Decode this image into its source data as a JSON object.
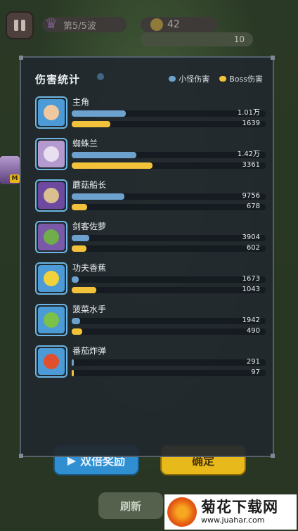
{
  "hud": {
    "wave": "第5/5波",
    "coins": "42",
    "progress": "10"
  },
  "panel": {
    "title": "伤害统计",
    "legend": {
      "mob": "小怪伤害",
      "boss": "Boss伤害"
    },
    "colors": {
      "mob": "#6da2cf",
      "boss": "#f2c23b"
    },
    "rows": [
      {
        "name": "主角",
        "mob": "1.01万",
        "boss": "1639",
        "mob_pct": 0.28,
        "boss_pct": 0.2,
        "bg": "#4d9bd6",
        "face": "#f0c8a0"
      },
      {
        "name": "蜘蛛兰",
        "mob": "1.42万",
        "boss": "3361",
        "mob_pct": 0.335,
        "boss_pct": 0.415,
        "bg": "#b59ad0",
        "face": "#e8e0f0"
      },
      {
        "name": "蘑菇船长",
        "mob": "9756",
        "boss": "678",
        "mob_pct": 0.272,
        "boss_pct": 0.08,
        "bg": "#6d4aa0",
        "face": "#d9c090"
      },
      {
        "name": "剑客佐萝",
        "mob": "3904",
        "boss": "602",
        "mob_pct": 0.09,
        "boss_pct": 0.075,
        "bg": "#7a5aa8",
        "face": "#6fae4a"
      },
      {
        "name": "功夫香蕉",
        "mob": "1673",
        "boss": "1043",
        "mob_pct": 0.035,
        "boss_pct": 0.125,
        "bg": "#4d9bd6",
        "face": "#f2d23a"
      },
      {
        "name": "菠菜水手",
        "mob": "1942",
        "boss": "490",
        "mob_pct": 0.045,
        "boss_pct": 0.055,
        "bg": "#4d9bd6",
        "face": "#7cc14a"
      },
      {
        "name": "番茄炸弹",
        "mob": "291",
        "boss": "97",
        "mob_pct": 0.006,
        "boss_pct": 0.01,
        "bg": "#4d9bd6",
        "face": "#e0502e"
      }
    ]
  },
  "buttons": {
    "share": "双倍奖励",
    "confirm": "确定",
    "refresh": "刷新"
  },
  "watermark": {
    "title": "菊花下载网",
    "url": "www.juahar.com"
  }
}
